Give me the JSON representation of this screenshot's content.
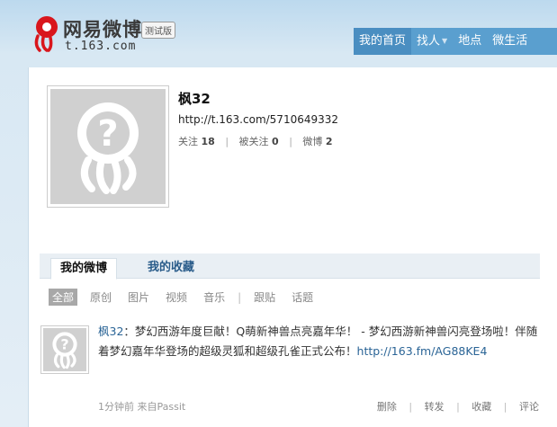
{
  "header": {
    "logo_name": "网易微博",
    "logo_domain": "t.163.com",
    "logo_badge": "测试版",
    "nav": [
      {
        "label": "我的首页"
      },
      {
        "label": "找人"
      },
      {
        "label": "地点"
      },
      {
        "label": "微生活"
      }
    ]
  },
  "profile": {
    "name": "枫32",
    "url": "http://t.163.com/5710649332",
    "following_label": "关注",
    "following": "18",
    "followers_label": "被关注",
    "followers": "0",
    "posts_label": "微博",
    "posts": "2"
  },
  "tabs": [
    {
      "label": "我的微博"
    },
    {
      "label": "我的收藏"
    }
  ],
  "filters": [
    "全部",
    "原创",
    "图片",
    "视频",
    "音乐",
    "跟贴",
    "话题"
  ],
  "feed": {
    "author": "枫32",
    "colon": "：",
    "text": "梦幻西游年度巨献！Q萌新神兽点亮嘉年华！ - 梦幻西游新神兽闪亮登场啦！伴随着梦幻嘉年华登场的超级灵狐和超级孔雀正式公布！",
    "link": "http://163.fm/AG88KE4",
    "time": "1分钟前",
    "source": "来自Passit",
    "actions": [
      "删除",
      "转发",
      "收藏",
      "评论"
    ]
  }
}
